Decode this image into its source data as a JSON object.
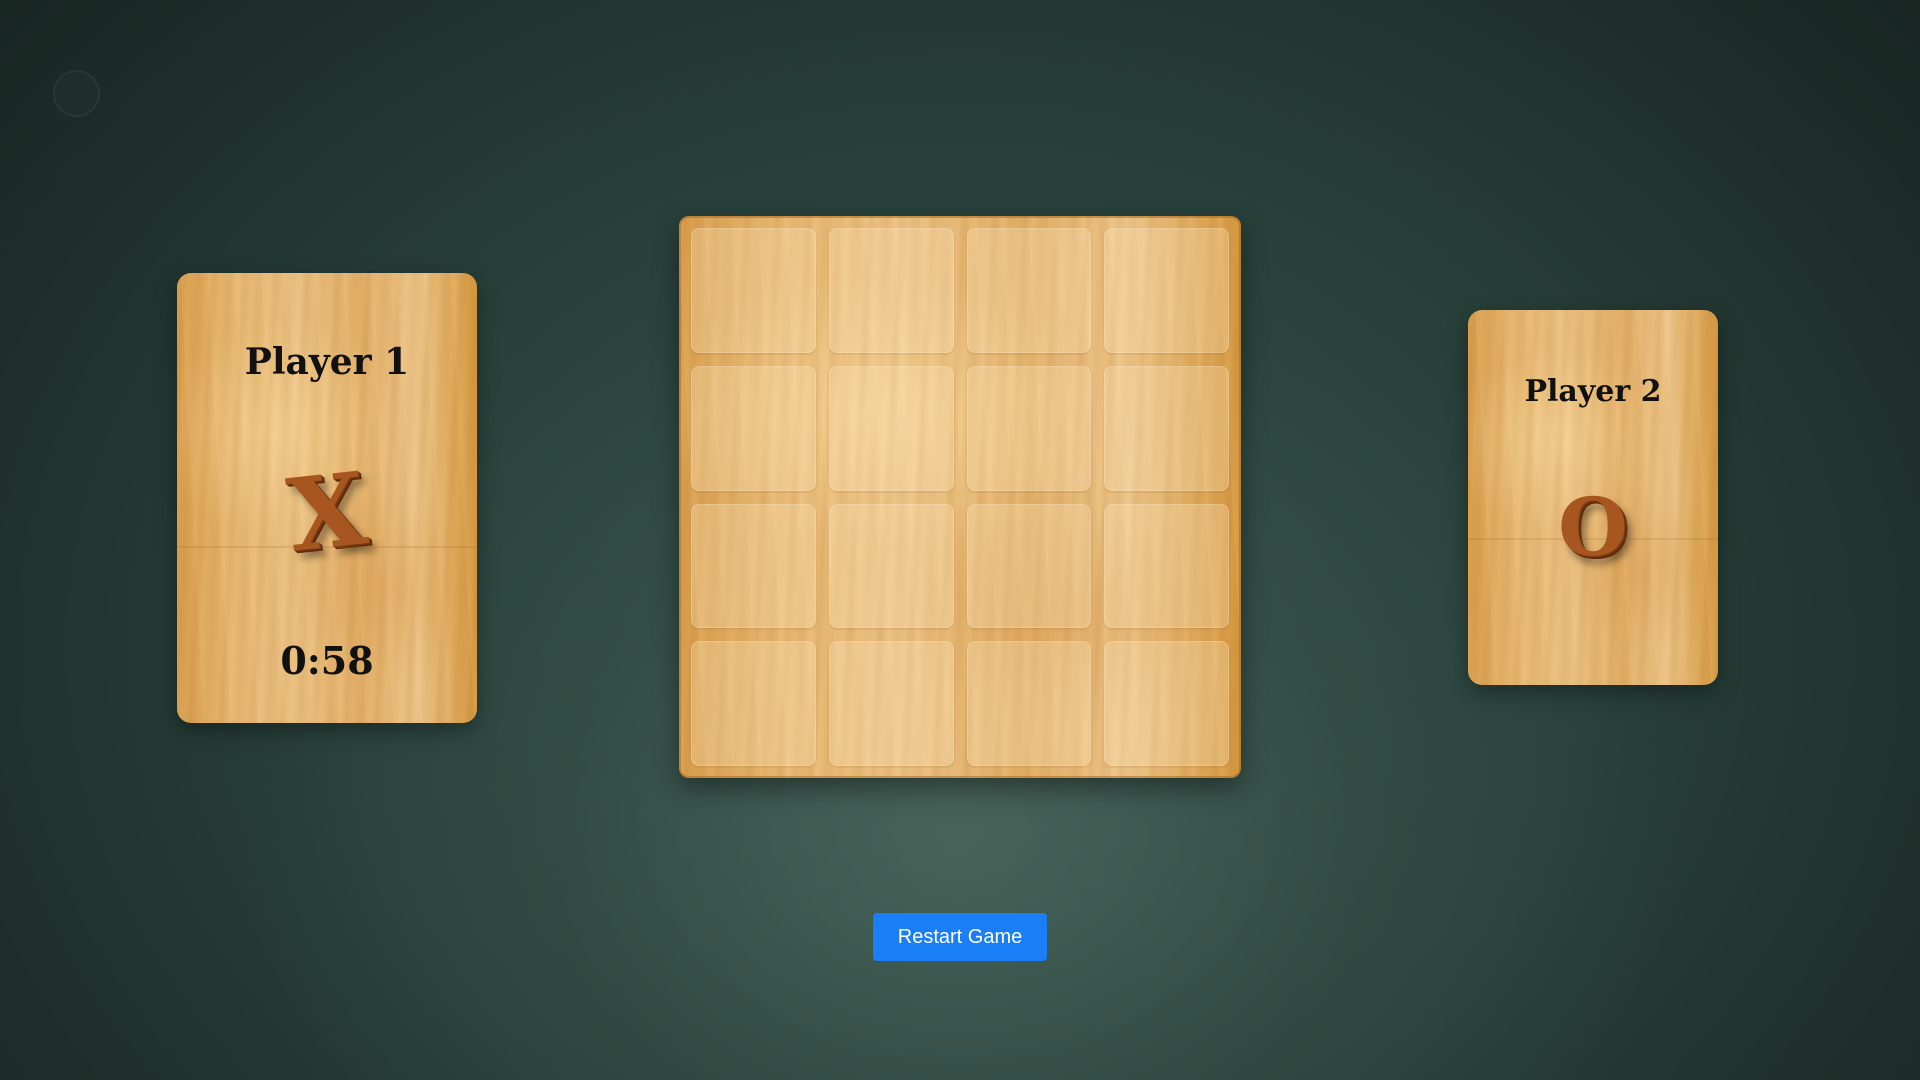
{
  "player1": {
    "name": "Player 1",
    "symbol": "X",
    "timer": "0:58"
  },
  "player2": {
    "name": "Player 2",
    "symbol": "O"
  },
  "board": {
    "rows": 4,
    "cols": 4,
    "cells": [
      "",
      "",
      "",
      "",
      "",
      "",
      "",
      "",
      "",
      "",
      "",
      "",
      "",
      "",
      "",
      ""
    ]
  },
  "controls": {
    "restart_label": "Restart Game"
  },
  "colors": {
    "button": "#1a7ef7"
  }
}
